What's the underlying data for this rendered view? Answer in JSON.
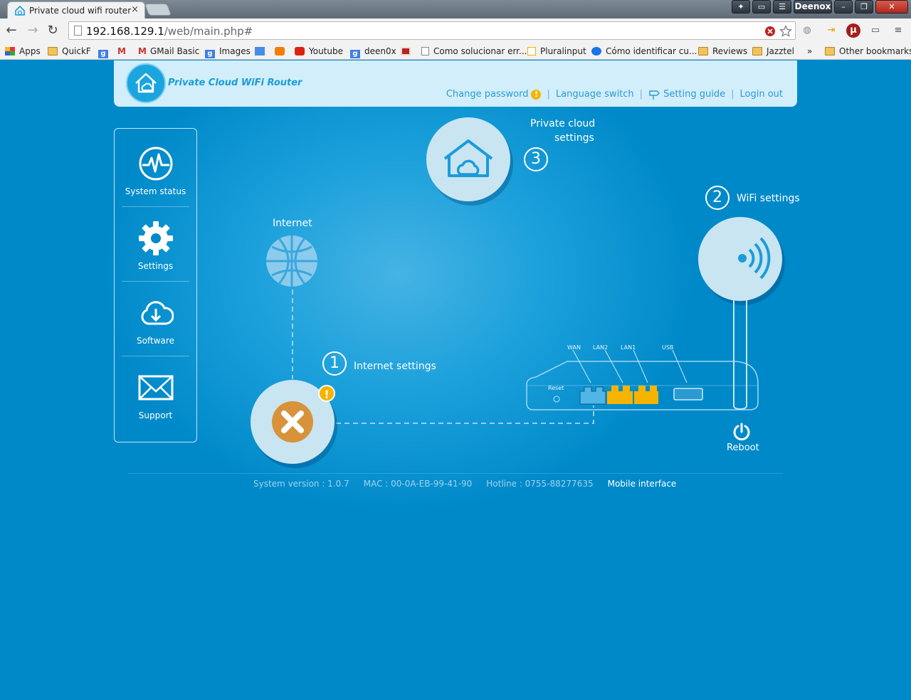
{
  "browser": {
    "tab_title": "Private cloud wifi router",
    "tab_close": "×",
    "user_name": "Deenox",
    "url_host": "192.168.129.1",
    "url_path": "/web/main.php#",
    "bookmarks": [
      {
        "label": "Apps",
        "icon": "apps-grid-icon"
      },
      {
        "label": "QuickF",
        "icon": "folder-icon"
      },
      {
        "label": "",
        "icon": "google-icon"
      },
      {
        "label": "",
        "icon": "gmail-icon"
      },
      {
        "label": "GMail Basic",
        "icon": "gmail-icon"
      },
      {
        "label": "Images",
        "icon": "google-icon"
      },
      {
        "label": "",
        "icon": "translate-icon"
      },
      {
        "label": "",
        "icon": "blogger-icon"
      },
      {
        "label": "Youtube",
        "icon": "youtube-icon"
      },
      {
        "label": "deen0x",
        "icon": "google-icon"
      },
      {
        "label": "",
        "icon": "red-square-icon"
      },
      {
        "label": "Como solucionar err...",
        "icon": "page-icon"
      },
      {
        "label": "Pluralinput",
        "icon": "play-icon"
      },
      {
        "label": "Cómo identificar cu...",
        "icon": "accessibility-icon"
      },
      {
        "label": "Reviews",
        "icon": "folder-icon"
      },
      {
        "label": "Jazztel",
        "icon": "folder-icon"
      },
      {
        "label": "»",
        "icon": ""
      },
      {
        "label": "Other bookmarks",
        "icon": "folder-icon"
      }
    ]
  },
  "header": {
    "logo_text": "Private Cloud WiFi Router",
    "links": {
      "change_password": "Change password",
      "language_switch": "Language switch",
      "setting_guide": "Setting guide",
      "login_out": "Login out",
      "separator": "|",
      "warning": "!"
    }
  },
  "sidebar": {
    "system_status": "System status",
    "settings": "Settings",
    "software": "Software",
    "support": "Support"
  },
  "diagram": {
    "private_cloud_line1": "Private cloud",
    "private_cloud_line2": "settings",
    "num_private_cloud": "3",
    "wifi_label": "WiFi settings",
    "num_wifi": "2",
    "internet_label": "Internet",
    "internet_settings_label": "Internet settings",
    "num_internet": "1",
    "warning": "!",
    "ports": {
      "wan": "WAN",
      "lan2": "LAN2",
      "lan1": "LAN1",
      "usb": "USB",
      "reset": "Reset"
    },
    "reboot": "Reboot"
  },
  "footer": {
    "system_version": "System version : 1.0.7",
    "mac": "MAC : 00-0A-EB-99-41-90",
    "hotline": "Hotline : 0755-88277635",
    "mobile_interface": "Mobile interface"
  },
  "colors": {
    "background": "#0089c9",
    "header_bg": "#d2eefb",
    "accent": "#1a9cd9",
    "warning": "#f5b400",
    "error_x": "#d8923a",
    "port_yellow": "#f5b400",
    "port_blue": "#4fb6e6"
  }
}
